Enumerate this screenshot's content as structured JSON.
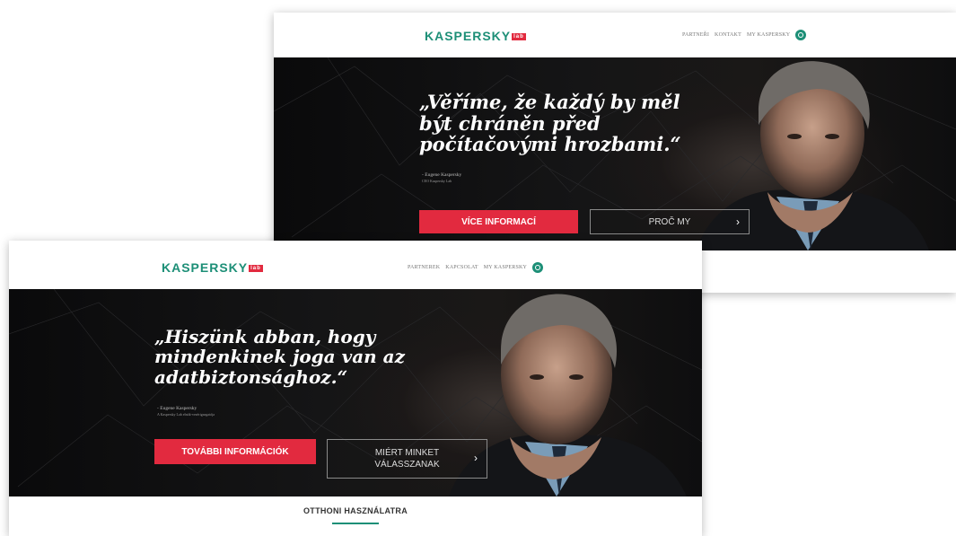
{
  "back": {
    "logo_text": "KASPERSKY",
    "logo_badge": "lab",
    "nav": [
      "PARTNEŘI",
      "KONTAKT",
      "MY KASPERSKY"
    ],
    "quote": "„Věříme, že každý by měl být chráněn před počítačovými hrozbami.“",
    "author_name": "- Eugene Kaspersky",
    "author_role": "CEO Kaspersky Lab",
    "button_primary": "VÍCE INFORMACÍ",
    "button_secondary": "PROČ MY"
  },
  "front": {
    "logo_text": "KASPERSKY",
    "logo_badge": "lab",
    "nav": [
      "PARTNEREK",
      "KAPCSOLAT",
      "MY KASPERSKY"
    ],
    "quote": "„Hiszünk abban, hogy mindenkinek joga van az adatbiztonsághoz.“",
    "author_name": "- Eugene Kaspersky",
    "author_role": "A Kaspersky Lab elnök-vezérigazgatója",
    "button_primary": "TOVÁBBI INFORMÁCIÓK",
    "button_secondary": "MIÉRT MINKET VÁLASSZANAK",
    "section_title": "OTTHONI HASZNÁLATRA"
  },
  "colors": {
    "brand_green": "#1d8f77",
    "accent_red": "#e22a3f",
    "hero_bg": "#0b0b0c"
  }
}
